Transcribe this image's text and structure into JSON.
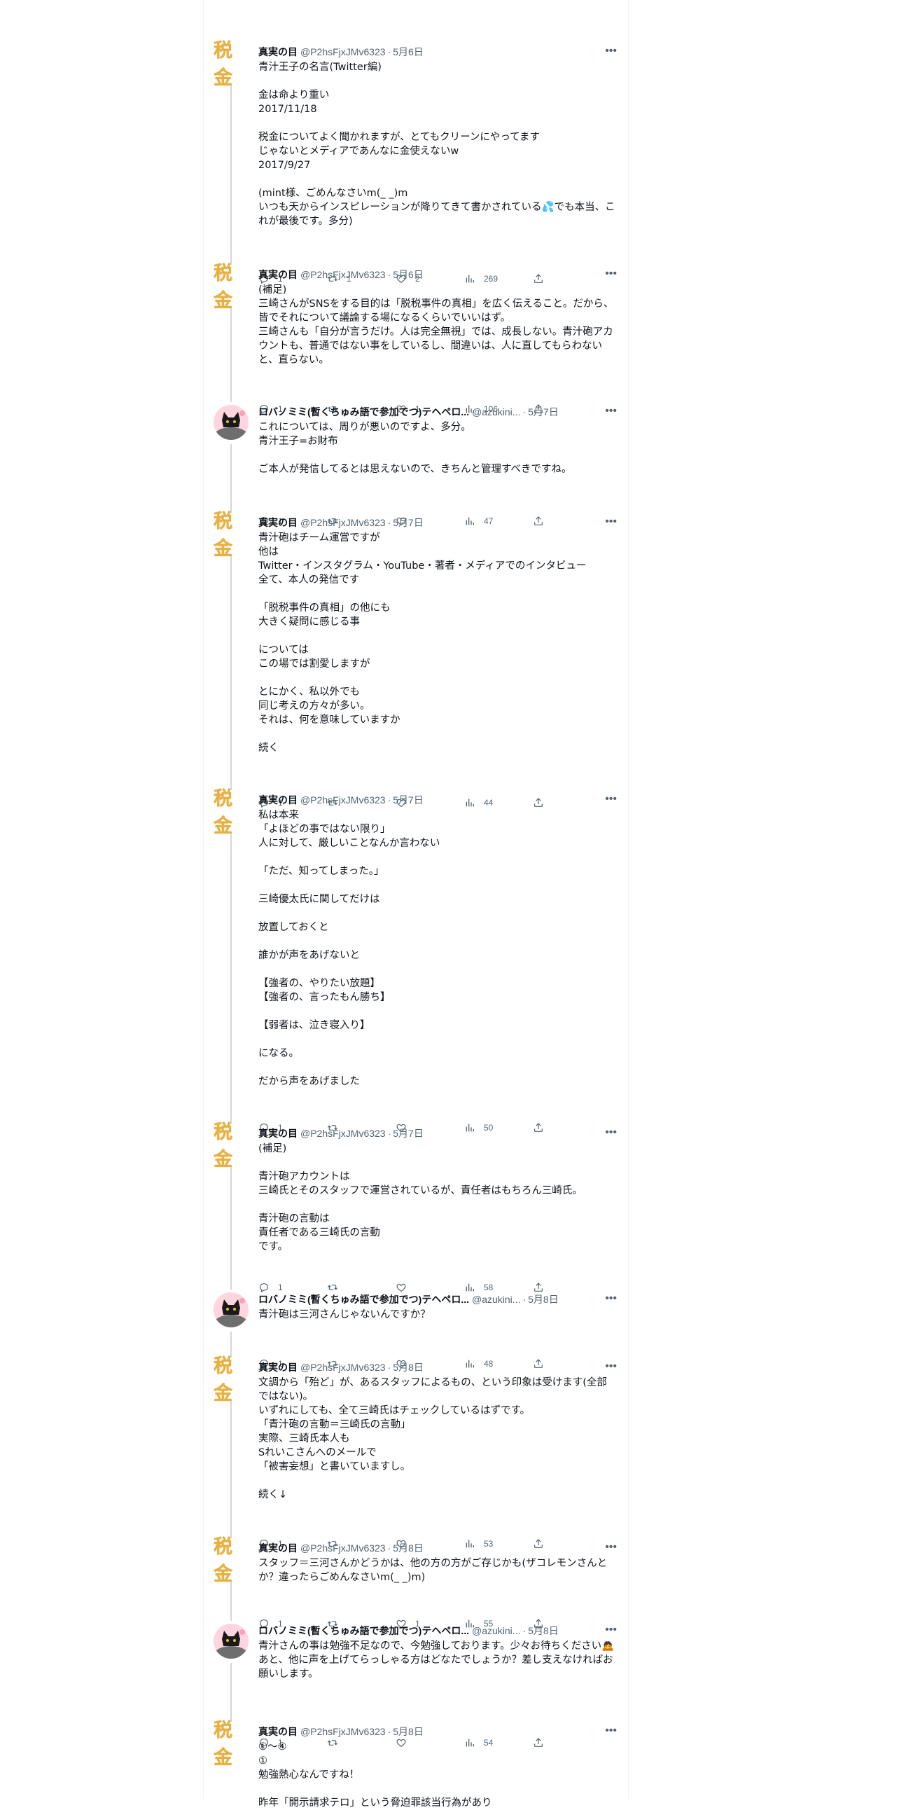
{
  "tweets": [
    {
      "name": "真実の目",
      "handle": "@P2hsFjxJMv6323",
      "date": "5月6日",
      "avatar": "zeikin",
      "body": "青汁王子の名言(Twitter編)\n\n金は命より重い\n2017/11/18\n\n税金についてよく聞かれますが、とてもクリーンにやってます\nじゃないとメディアであんなに金使えないw\n2017/9/27\n\n(mint様、ごめんなさいm(_ _)m\nいつも天からインスピレーションが降りてきて書かされている💦でも本当、これが最後です。多分)",
      "reply": "1",
      "retweet": "1",
      "like": "2",
      "views": "269"
    },
    {
      "name": "真実の目",
      "handle": "@P2hsFjxJMv6323",
      "date": "5月6日",
      "avatar": "zeikin",
      "body": "(補足)\n三崎さんがSNSをする目的は「脱税事件の真相」を広く伝えること。だから、皆でそれについて議論する場になるくらいでいいはず。\n三崎さんも「自分が言うだけ。人は完全無視」では、成長しない。青汁砲アカウントも、普通ではない事をしているし、間違いは、人に直してもらわないと、直らない。",
      "reply": "1",
      "retweet": "",
      "like": "1",
      "views": "106"
    },
    {
      "name": "ロバノミミ(暫くちゅみ語で参加でつ)テヘペロ...",
      "handle": "@azukini...",
      "date": "5月7日",
      "avatar": "cat",
      "body": "これについては、周りが悪いのですよ、多分。\n青汁王子=お財布\n\nご本人が発信してるとは思えないので、きちんと管理すべきですね。",
      "reply": "1",
      "retweet": "",
      "like": "",
      "views": "47"
    },
    {
      "name": "真実の目",
      "handle": "@P2hsFjxJMv6323",
      "date": "5月7日",
      "avatar": "zeikin",
      "body": "青汁砲はチーム運営ですが\n他は\nTwitter・インスタグラム・YouTube・著者・メディアでのインタビュー\n全て、本人の発信です\n\n「脱税事件の真相」の他にも\n大きく疑問に感じる事\n\nについては\nこの場では割愛しますが\n\nとにかく、私以外でも\n同じ考えの方々が多い。\nそれは、何を意味していますか\n\n続く",
      "reply": "1",
      "retweet": "",
      "like": "",
      "views": "44"
    },
    {
      "name": "真実の目",
      "handle": "@P2hsFjxJMv6323",
      "date": "5月7日",
      "avatar": "zeikin",
      "body": "私は本来\n「よほどの事ではない限り」\n人に対して、厳しいことなんか言わない\n\n「ただ、知ってしまった。」\n\n三崎優太氏に関してだけは\n\n放置しておくと\n\n誰かが声をあげないと\n\n【強者の、やりたい放題】\n【強者の、言ったもん勝ち】\n\n【弱者は、泣き寝入り】\n\nになる。\n\nだから声をあげました",
      "reply": "1",
      "retweet": "",
      "like": "",
      "views": "50"
    },
    {
      "name": "真実の目",
      "handle": "@P2hsFjxJMv6323",
      "date": "5月7日",
      "avatar": "zeikin",
      "body": "(補足)\n\n青汁砲アカウントは\n三崎氏とそのスタッフで運営されているが、責任者はもちろん三崎氏。\n\n青汁砲の言動は\n責任者である三崎氏の言動\nです。",
      "reply": "1",
      "retweet": "",
      "like": "",
      "views": "58"
    },
    {
      "name": "ロバノミミ(暫くちゅみ語で参加でつ)テヘペロ...",
      "handle": "@azukini...",
      "date": "5月8日",
      "avatar": "cat",
      "body": "青汁砲は三河さんじゃないんですか？",
      "reply": "1",
      "retweet": "",
      "like": "",
      "views": "48"
    },
    {
      "name": "真実の目",
      "handle": "@P2hsFjxJMv6323",
      "date": "5月8日",
      "avatar": "zeikin",
      "body": "文調から「殆ど」が、あるスタッフによるもの、という印象は受けます(全部ではない)。\nいずれにしても、全て三崎氏はチェックしているはずです。\n「青汁砲の言動＝三崎氏の言動」\n実際、三崎氏本人も\nSれいこさんへのメールで\n「被害妄想」と書いていますし。\n\n続く↓",
      "reply": "1",
      "retweet": "",
      "like": "",
      "views": "53"
    },
    {
      "name": "真実の目",
      "handle": "@P2hsFjxJMv6323",
      "date": "5月8日",
      "avatar": "zeikin",
      "body": "スタッフ＝三河さんかどうかは、他の方の方がご存じかも(ザコレモンさんとか？違ったらごめんなさいm(_ _)m)",
      "reply": "1",
      "retweet": "",
      "like": "1",
      "views": "55"
    },
    {
      "name": "ロバノミミ(暫くちゅみ語で参加でつ)テヘペロ...",
      "handle": "@azukini...",
      "date": "5月8日",
      "avatar": "cat",
      "body": "青汁さんの事は勉強不足なので、今勉強しております。少々お待ちください🙇あと、他に声を上げてらっしゃる方はどなたでしょうか？差し支えなければお願いします。",
      "reply": "1",
      "retweet": "",
      "like": "",
      "views": "54"
    },
    {
      "name": "真実の目",
      "handle": "@P2hsFjxJMv6323",
      "date": "5月8日",
      "avatar": "zeikin",
      "body": "①～④\n①\n勉強熱心なんですね！\n\n昨年「開示請求テロ」という脅迫罪該当行為があり",
      "reply": "",
      "retweet": "",
      "like": "",
      "views": ""
    }
  ],
  "avatar_text": "税金",
  "more_icon": "•••"
}
